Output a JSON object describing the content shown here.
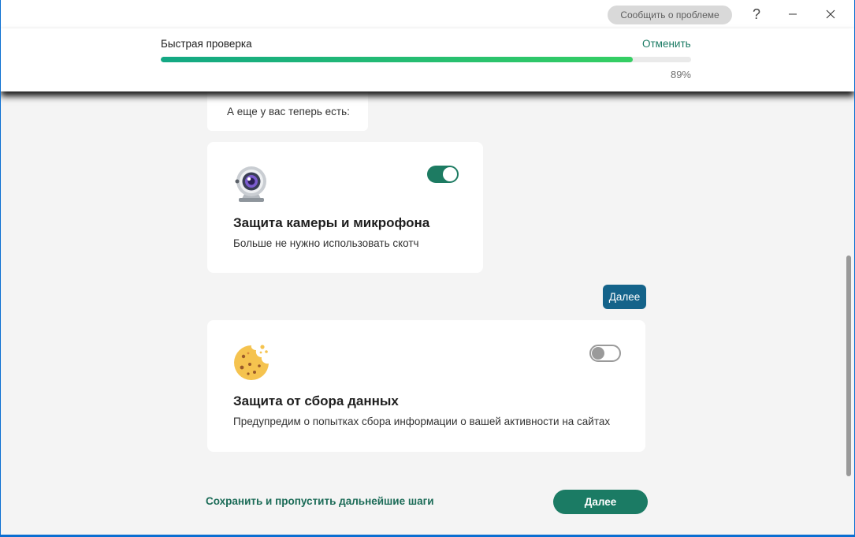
{
  "titlebar": {
    "report_label": "Сообщить о проблеме",
    "help_label": "?",
    "minimize_label": "—",
    "close_label": "✕"
  },
  "scan": {
    "title": "Быстрая проверка",
    "cancel_label": "Отменить",
    "progress_text": "89%",
    "progress_value": 0.89
  },
  "note": {
    "text": "А еще у вас теперь есть:"
  },
  "cards": [
    {
      "icon": "webcam-icon",
      "title": "Защита камеры и микрофона",
      "description": "Больше не нужно использовать скотч",
      "enabled": true
    },
    {
      "icon": "cookie-icon",
      "title": "Защита от сбора данных",
      "description": "Предупредим о попытках сбора информации о вашей активности на сайтах",
      "enabled": false
    }
  ],
  "tip": {
    "next_label": "Далее"
  },
  "footer": {
    "skip_label": "Сохранить и пропустить дальнейшие шаги",
    "next_label": "Далее"
  },
  "colors": {
    "accent": "#1b7b64",
    "tip_blue": "#14638a",
    "progress_start": "#13a884",
    "progress_end": "#35cf63"
  }
}
